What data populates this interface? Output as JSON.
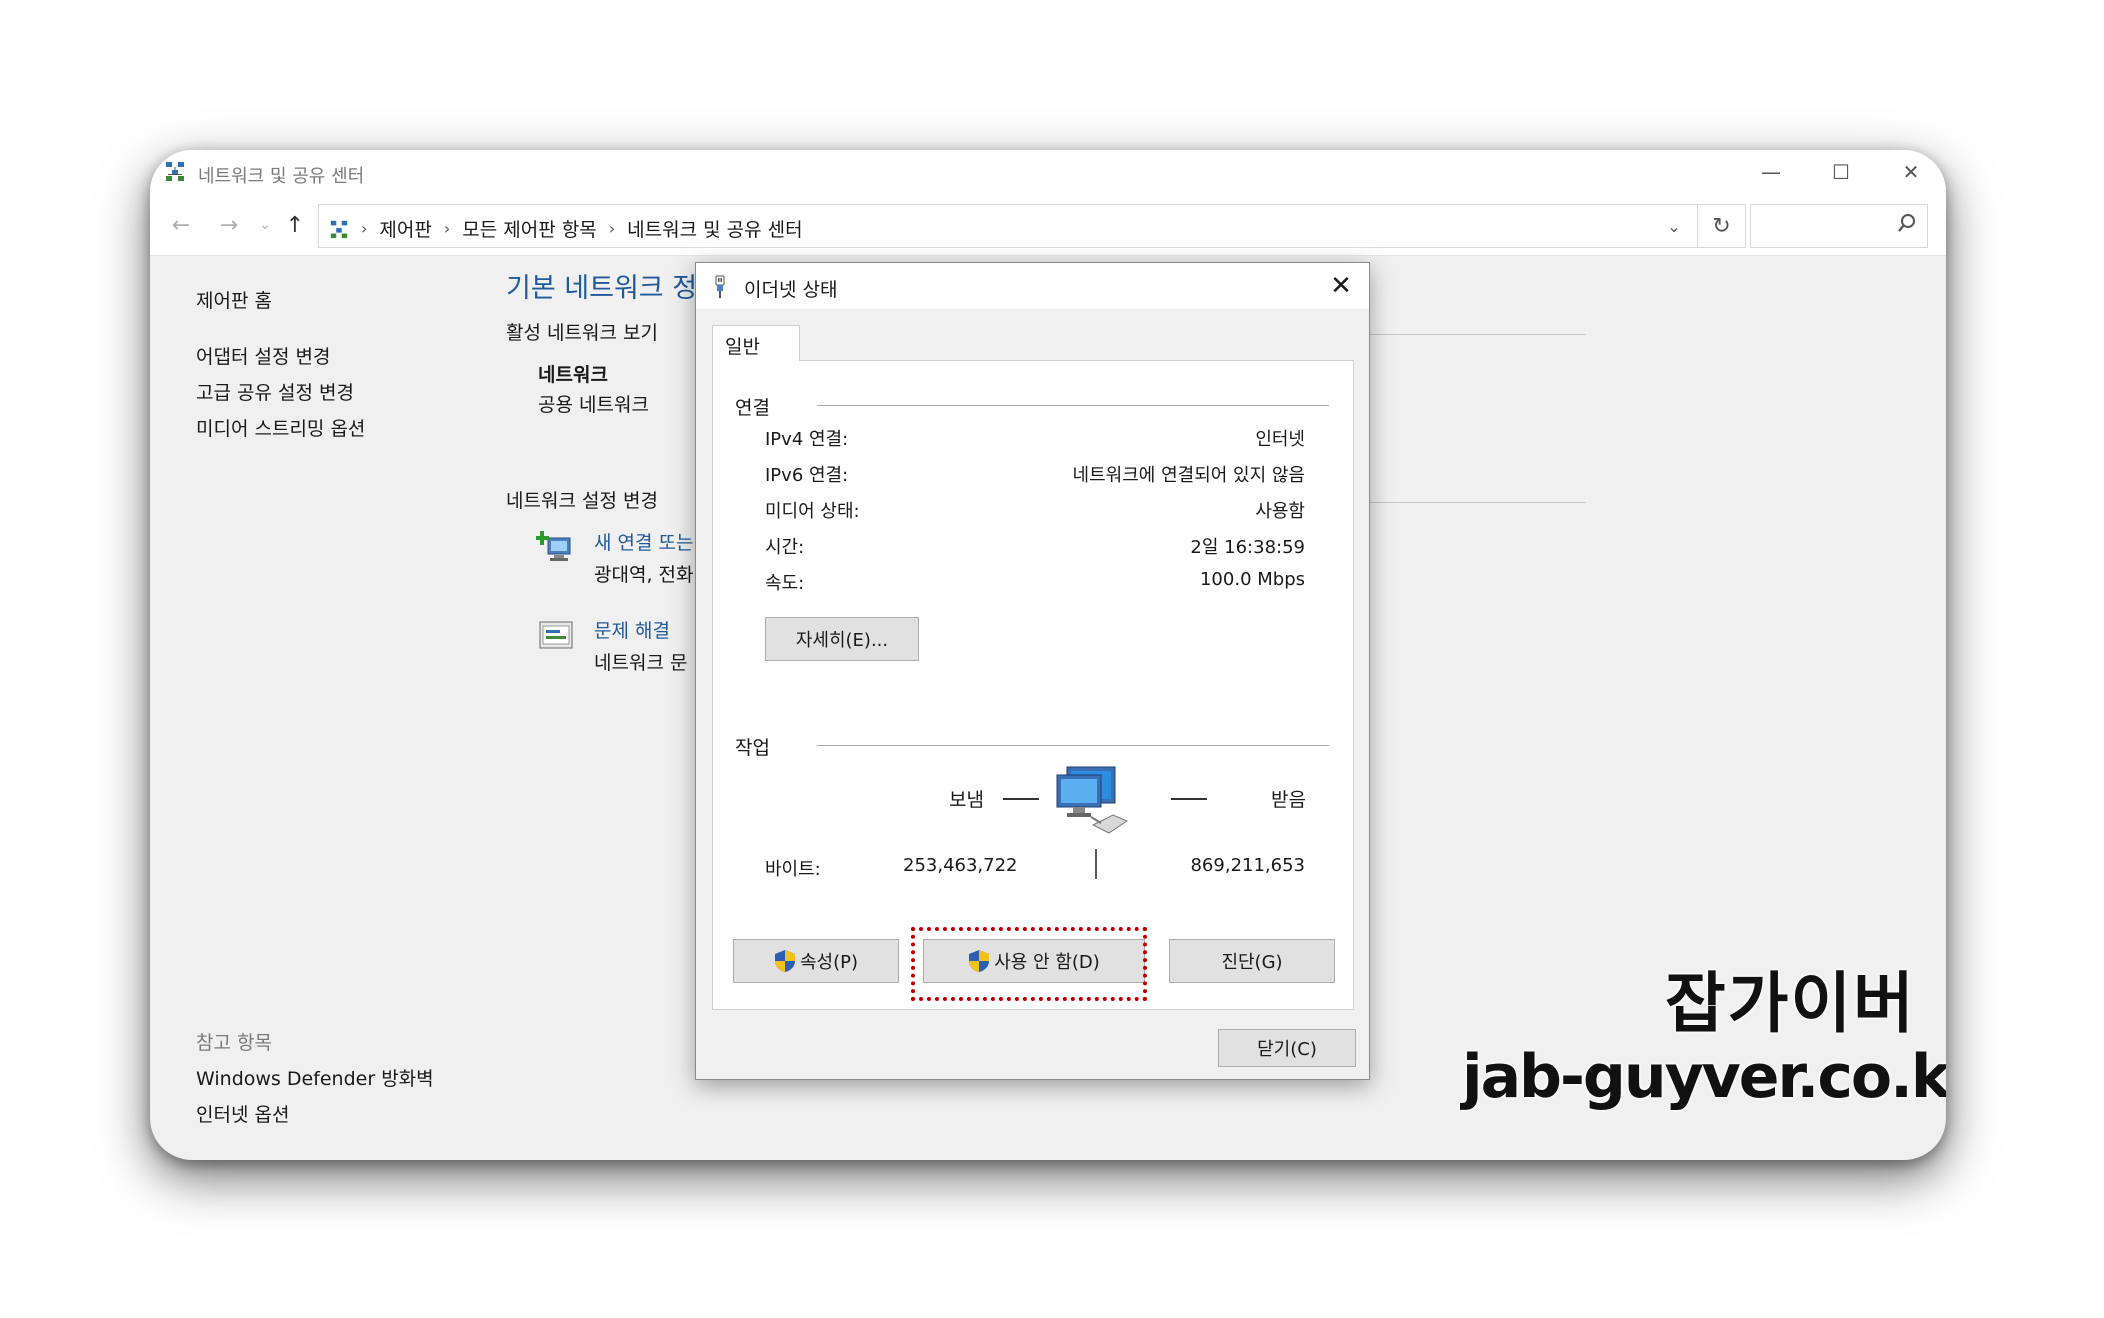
{
  "window": {
    "title": "네트워크 및 공유 센터",
    "minimize_glyph": "—",
    "maximize_glyph": "☐",
    "close_glyph": "✕"
  },
  "navigation": {
    "back_glyph": "←",
    "forward_glyph": "→",
    "recent_glyph": "⌄",
    "up_glyph": "↑",
    "breadcrumbs": [
      "제어판",
      "모든 제어판 항목",
      "네트워크 및 공유 센터"
    ],
    "dropdown_glyph": "⌄",
    "refresh_glyph": "↻",
    "search_placeholder": "",
    "search_glyph": "⚲"
  },
  "sidebar": {
    "home": "제어판 홈",
    "links": [
      "어댑터 설정 변경",
      "고급 공유 설정 변경",
      "미디어 스트리밍 옵션"
    ],
    "see_also_caption": "참고 항목",
    "see_also": [
      "Windows Defender 방화벽",
      "인터넷 옵션"
    ]
  },
  "main": {
    "heading": "기본 네트워크 정",
    "active_networks": "활성 네트워크 보기",
    "network_name": "네트워크",
    "network_type": "공용 네트워크",
    "change_settings": "네트워크 설정 변경",
    "new_connection_link": "새 연결 또는",
    "new_connection_desc": "광대역, 전화",
    "troubleshoot_link": "문제 해결",
    "troubleshoot_desc": "네트워크 문"
  },
  "dialog": {
    "title": "이더넷 상태",
    "close_glyph": "✕",
    "tab": "일반",
    "connection_group": "연결",
    "rows": [
      {
        "label": "IPv4 연결:",
        "value": "인터넷"
      },
      {
        "label": "IPv6 연결:",
        "value": "네트워크에 연결되어 있지 않음"
      },
      {
        "label": "미디어 상태:",
        "value": "사용함"
      },
      {
        "label": "시간:",
        "value": "2일 16:38:59"
      },
      {
        "label": "속도:",
        "value": "100.0 Mbps"
      }
    ],
    "details_button": "자세히(E)...",
    "activity_group": "작업",
    "sent_label": "보냄",
    "received_label": "받음",
    "bytes_label": "바이트:",
    "bytes_sent": "253,463,722",
    "bytes_received": "869,211,653",
    "properties_button": "속성(P)",
    "disable_button": "사용 안 함(D)",
    "diagnose_button": "진단(G)",
    "close_button": "닫기(C)"
  },
  "watermark": {
    "name": "잡가이버",
    "site": "jab-guyver.co.kr"
  },
  "colors": {
    "link": "#1e5a9c",
    "highlight": "#c00000"
  }
}
